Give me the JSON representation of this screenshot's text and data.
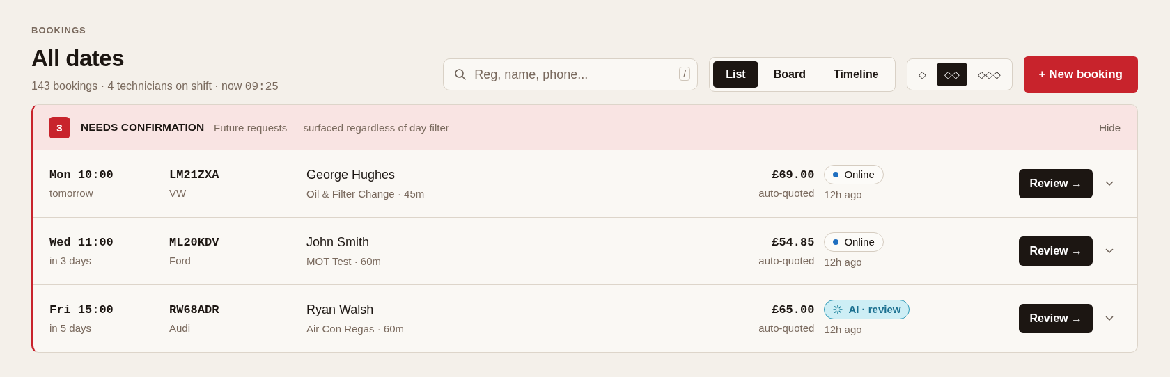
{
  "header": {
    "eyebrow": "BOOKINGS",
    "title": "All dates",
    "summary": "143 bookings · 4 technicians on shift · now ",
    "clock": "09:25"
  },
  "search": {
    "placeholder": "Reg, name, phone...",
    "shortcut": "/"
  },
  "views": [
    {
      "label": "List",
      "selected": true
    },
    {
      "label": "Board",
      "selected": false
    },
    {
      "label": "Timeline",
      "selected": false
    }
  ],
  "density": [
    {
      "label": "◇",
      "selected": false
    },
    {
      "label": "◇◇",
      "selected": true
    },
    {
      "label": "◇◇◇",
      "selected": false
    }
  ],
  "new_button": "+ New booking",
  "panel": {
    "count": "3",
    "title": "NEEDS CONFIRMATION",
    "subtitle": "Future requests — surfaced regardless of day filter",
    "hide": "Hide",
    "rows": [
      {
        "when": "Mon 10:00",
        "relative": "tomorrow",
        "reg": "LM21ZXA",
        "make": "VW",
        "customer": "George Hughes",
        "service": "Oil & Filter Change · 45m",
        "price": "£69.00",
        "price_note": "auto-quoted",
        "source": {
          "kind": "online",
          "label": "Online"
        },
        "age": "12h ago",
        "action": "Review →"
      },
      {
        "when": "Wed 11:00",
        "relative": "in 3 days",
        "reg": "ML20KDV",
        "make": "Ford",
        "customer": "John Smith",
        "service": "MOT Test · 60m",
        "price": "£54.85",
        "price_note": "auto-quoted",
        "source": {
          "kind": "online",
          "label": "Online"
        },
        "age": "12h ago",
        "action": "Review →"
      },
      {
        "when": "Fri 15:00",
        "relative": "in 5 days",
        "reg": "RW68ADR",
        "make": "Audi",
        "customer": "Ryan Walsh",
        "service": "Air Con Regas · 60m",
        "price": "£65.00",
        "price_note": "auto-quoted",
        "source": {
          "kind": "ai",
          "label": "AI · review"
        },
        "age": "12h ago",
        "action": "Review →"
      }
    ]
  }
}
